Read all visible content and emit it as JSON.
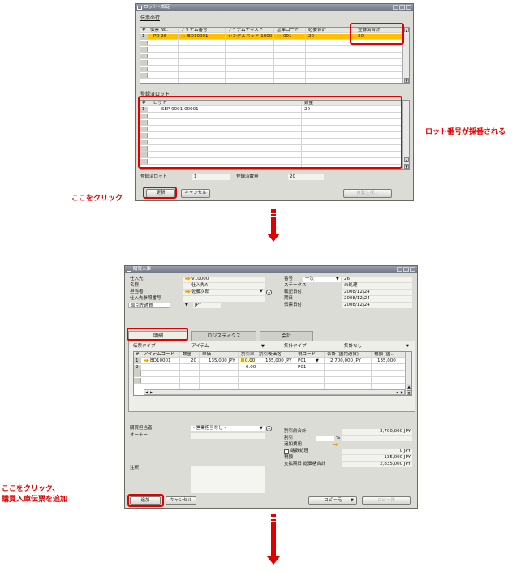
{
  "window1": {
    "title": "ロット - 設定",
    "section1_label": "伝票の行",
    "grid1": {
      "headers": [
        "#",
        "伝票 No.",
        "アイテム番号",
        "アイテムテキスト",
        "倉庫コード",
        "必要合計",
        "登録済合計"
      ],
      "rows": [
        [
          "1",
          "PD 26",
          "BD10001",
          "シングルベッド 10001",
          "001",
          "20",
          "20"
        ]
      ]
    },
    "section2_label": "登録済ロット",
    "grid2": {
      "headers": [
        "#",
        "ロット",
        "数量"
      ],
      "rows": [
        [
          "1",
          "SEP-0001-00001",
          "20"
        ]
      ]
    },
    "footer": {
      "count_label": "登録済ロット",
      "count_value": "1",
      "qty_label": "登録済数量",
      "qty_value": "20"
    },
    "buttons": {
      "update": "更新",
      "cancel": "キャンセル",
      "auto_create": "自動生成..."
    }
  },
  "annotations": {
    "lot_numbered": "ロット番号が採番される",
    "click_here": "ここをクリック",
    "click_here_add_1": "ここをクリック、",
    "click_here_add_2": "購買入庫伝票を追加"
  },
  "window2": {
    "title": "購買入庫",
    "header_left": {
      "supplier_label": "仕入先",
      "supplier_value": "V10000",
      "name_label": "名称",
      "name_value": "仕入先A",
      "contact_label": "担当者",
      "contact_value": "佐藤次郎",
      "ref_label": "仕入先参照番号",
      "ref_value": "",
      "currency_label": "取引先通貨",
      "currency_value": "JPY"
    },
    "header_right": {
      "number_label": "番号",
      "number_series": "一次",
      "number_value": "26",
      "status_label": "ステータス",
      "status_value": "未処理",
      "posting_label": "転記日付",
      "posting_value": "2008/12/24",
      "due_label": "期日",
      "due_value": "2008/12/24",
      "doc_date_label": "伝票日付",
      "doc_date_value": "2008/12/24"
    },
    "tabs": [
      "明細",
      "ロジスティクス",
      "会計"
    ],
    "line_type_label": "伝票タイプ",
    "line_type_value": "アイテム",
    "summary_type_label": "集計タイプ",
    "summary_type_value": "集計なし",
    "grid": {
      "headers": [
        "#",
        "アイテムコード",
        "数量",
        "単価",
        "割引率",
        "割引後価格",
        "税コード",
        "合計 (国内通貨)",
        "税額 (国..."
      ],
      "rows": [
        [
          "1",
          "BD10001",
          "20",
          "135,000 JPY",
          "0.00",
          "135,000 JPY",
          "P01",
          "2,700,000 JPY",
          "135,000"
        ],
        [
          "2",
          "",
          "",
          "",
          "0.00",
          "",
          "P01",
          "",
          ""
        ]
      ]
    },
    "footer_left": {
      "buyer_label": "購買担当者",
      "buyer_value": "- 営業担当なし -",
      "owner_label": "オーナー",
      "remarks_label": "注釈"
    },
    "footer_right": {
      "before_disc_label": "割引前合計",
      "before_disc_value": "2,700,000 JPY",
      "discount_label": "割引",
      "discount_pct": "%",
      "freight_label": "追加費用",
      "rounding_label": "端数処理",
      "rounding_value": "0 JPY",
      "tax_label": "税額",
      "tax_value": "135,000 JPY",
      "total_label": "支払期日 総価格合計",
      "total_value": "2,835,000 JPY"
    },
    "buttons": {
      "add": "追加",
      "cancel": "キャンセル",
      "copy_from": "コピー元",
      "copy_to": "コピー先"
    }
  }
}
